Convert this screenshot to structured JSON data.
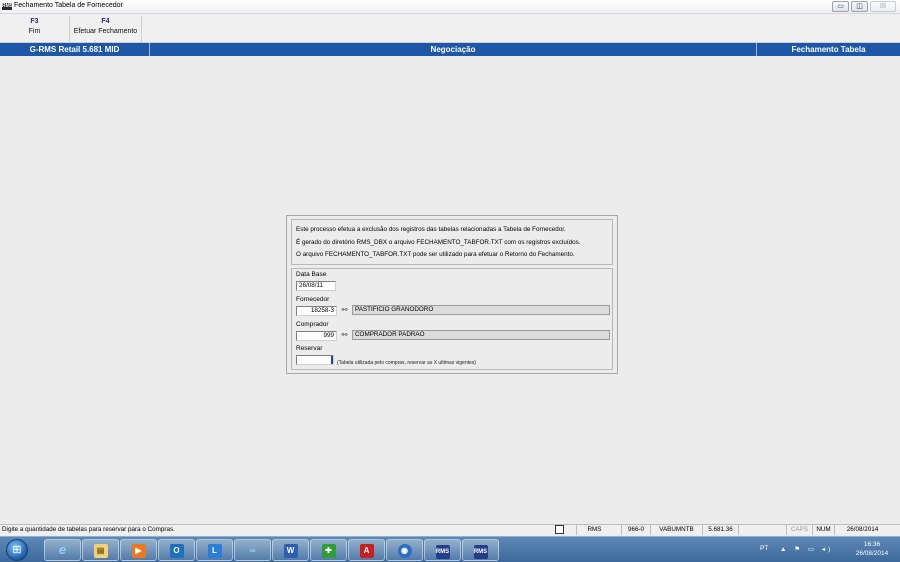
{
  "window": {
    "app_icon_text": "RMS",
    "title": "Fechamento Tabela de Fornecedor",
    "minimize_glyph": "▭",
    "maximize_glyph": "◫",
    "close_glyph": "☒"
  },
  "toolbar": {
    "items": [
      {
        "key": "F3",
        "label": "Fim"
      },
      {
        "key": "F4",
        "label": "Efetuar Fechamento"
      }
    ]
  },
  "header": {
    "system": "G-RMS Retail 5.681 MID",
    "module": "Negociação",
    "screen": "Fechamento Tabela"
  },
  "info": {
    "line1": "Este processo efetua a exclusão dos registros das tabelas relacionadas a Tabela de Fornecedor.",
    "line2": "É gerado do diretório RMS_DBX o arquivo FECHAMENTO_TABFOR.TXT com os registros excluídos.",
    "line3": "O arquivo FECHAMENTO_TABFOR.TXT pode ser utilizado para efetuar o Retorno do Fechamento."
  },
  "form": {
    "data_base": {
      "label": "Data Base",
      "value": "26/08/11"
    },
    "fornecedor": {
      "label": "Fornecedor",
      "code": "18258-3",
      "name": "PASTIFICIO GRANODORO"
    },
    "comprador": {
      "label": "Comprador",
      "code": "999",
      "name": "COMPRADOR PADRAO"
    },
    "reservar": {
      "label": "Reservar",
      "value": "",
      "hint": "(Tabela utilizada pelo compras, reservar as X ultimas vigentes)"
    }
  },
  "statusbar": {
    "message": "Digite a quantidade de tabelas para reservar para o Compras.",
    "system": "RMS",
    "code": "966-0",
    "program": "VABUMNTB",
    "version": "5.681.36",
    "empty": "",
    "caps": "CAPS",
    "num": "NUM",
    "date": "26/08/2014"
  },
  "taskbar": {
    "apps": [
      {
        "name": "internet-explorer",
        "glyph": "e"
      },
      {
        "name": "file-explorer",
        "glyph": "▤"
      },
      {
        "name": "media-player",
        "glyph": "▶"
      },
      {
        "name": "outlook",
        "glyph": "O"
      },
      {
        "name": "lync",
        "glyph": "L"
      },
      {
        "name": "infinity-app",
        "glyph": "∞"
      },
      {
        "name": "word",
        "glyph": "W"
      },
      {
        "name": "green-app",
        "glyph": "✚"
      },
      {
        "name": "acrobat",
        "glyph": "A"
      },
      {
        "name": "blue-app",
        "glyph": "◉"
      },
      {
        "name": "rms-app-1",
        "glyph": "RMS"
      },
      {
        "name": "rms-app-2",
        "glyph": "RMS"
      }
    ],
    "language": "PT",
    "time": "16:36",
    "date": "26/08/2014"
  },
  "colors": {
    "header_blue": "#1f57a8",
    "fkey_blue": "#1c2f7c"
  }
}
